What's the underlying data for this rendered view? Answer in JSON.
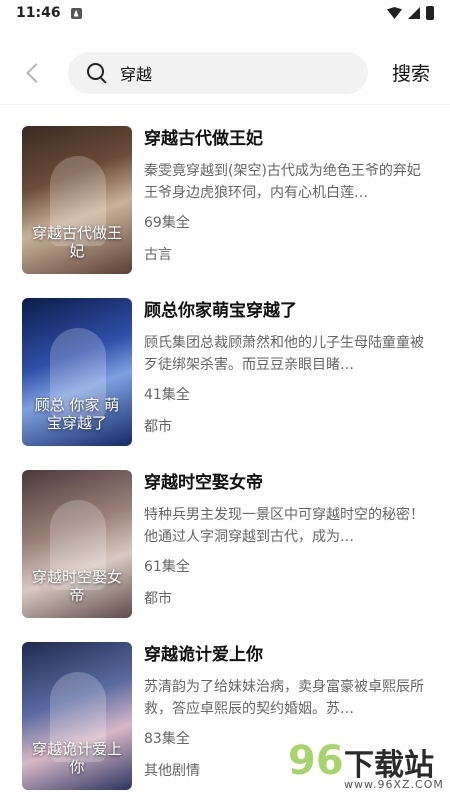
{
  "status_bar": {
    "time": "11:46"
  },
  "search": {
    "query": "穿越",
    "button_label": "搜索"
  },
  "results": [
    {
      "cover_text": "穿越古代做王妃",
      "title": "穿越古代做王妃",
      "description": "秦雯竟穿越到(架空)古代成为绝色王爷的弃妃王爷身边虎狼环伺，内有心机白莲…",
      "episodes": "69集全",
      "genre": "古言"
    },
    {
      "cover_text": "顾总 你家 萌宝穿越了",
      "title": "顾总你家萌宝穿越了",
      "description": "顾氏集团总裁顾萧然和他的儿子生母陆童童被歹徒绑架杀害。而豆豆亲眼目睹…",
      "episodes": "41集全",
      "genre": "都市"
    },
    {
      "cover_text": "穿越时空娶女帝",
      "title": "穿越时空娶女帝",
      "description": "特种兵男主发现一景区中可穿越时空的秘密！他通过人字洞穿越到古代，成为…",
      "episodes": "61集全",
      "genre": "都市"
    },
    {
      "cover_text": "穿越诡计爱上你",
      "title": "穿越诡计爱上你",
      "description": "苏清韵为了给妹妹治病，卖身富豪被卓熙辰所救，答应卓熙辰的契约婚姻。苏…",
      "episodes": "83集全",
      "genre": "其他剧情"
    }
  ],
  "watermark": {
    "digits": "96",
    "name": "下载站",
    "url": "www.96XZ.COM"
  },
  "colors": {
    "watermark_green": "#a8d46e",
    "search_bg": "#f2f2f2"
  }
}
